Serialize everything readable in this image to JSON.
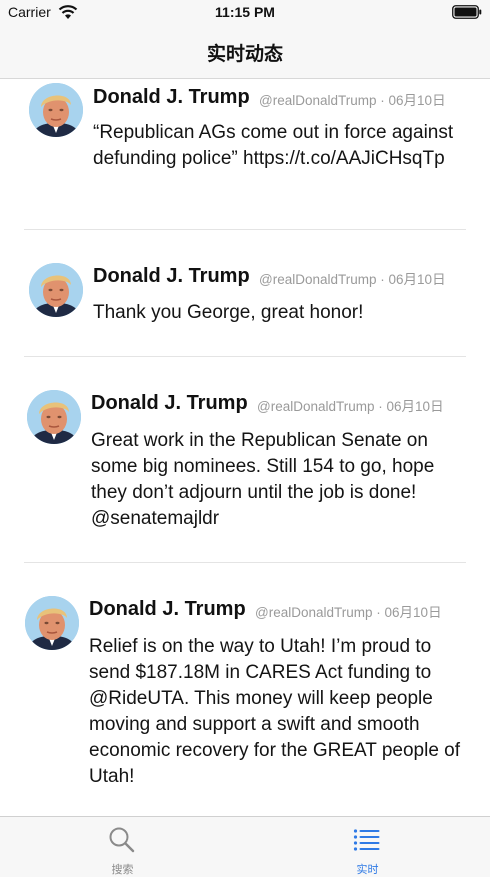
{
  "status_bar": {
    "carrier": "Carrier",
    "time": "11:15 PM"
  },
  "nav": {
    "title": "实时动态"
  },
  "tweets": [
    {
      "name": "Donald J. Trump",
      "handle": "@realDonaldTrump",
      "separator": "·",
      "date": "06月10日",
      "text": "“Republican AGs come out in force against defunding police” https://t.co/AAJiCHsqTp"
    },
    {
      "name": "Donald J. Trump",
      "handle": "@realDonaldTrump",
      "separator": "·",
      "date": "06月10日",
      "text": "Thank you George, great honor!"
    },
    {
      "name": "Donald J. Trump",
      "handle": "@realDonaldTrump",
      "separator": "·",
      "date": "06月10日",
      "text": "Great work in the Republican Senate on some big nominees. Still 154 to go, hope they don’t adjourn until the job is done! @senatemajldr"
    },
    {
      "name": "Donald J. Trump",
      "handle": "@realDonaldTrump",
      "separator": "·",
      "date": "06月10日",
      "text": "Relief is on the way to Utah! I’m proud to send $187.18M in CARES Act funding to @RideUTA. This money will keep people moving and support a swift and smooth economic recovery for the GREAT people of Utah!"
    }
  ],
  "tab_bar": {
    "items": [
      {
        "label": "搜索",
        "icon": "search-icon",
        "selected": false
      },
      {
        "label": "实时",
        "icon": "list-icon",
        "selected": true
      }
    ],
    "active_color": "#2f7ae5",
    "inactive_color": "#8a8a8a"
  }
}
